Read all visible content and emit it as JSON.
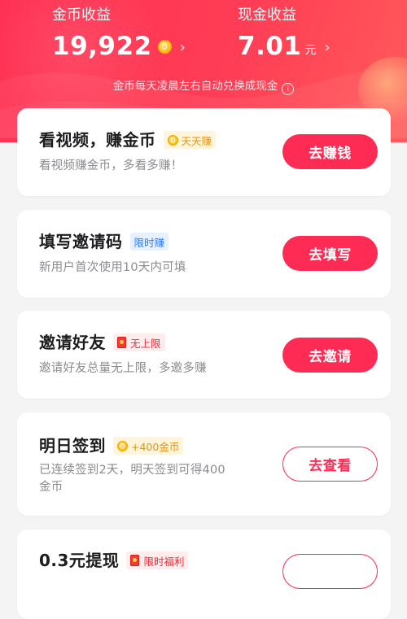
{
  "header": {
    "coins_label": "金币收益",
    "coins_value": "19,922",
    "cash_label": "现金收益",
    "cash_value": "7.01",
    "cash_unit": "元",
    "notice": "金币每天凌晨左右自动兑换成现金",
    "chevron": "›",
    "info": "i"
  },
  "tasks": [
    {
      "title": "看视频，赚金币",
      "tag": "天天赚",
      "tag_style": "gold",
      "tag_icon": "coin-icon",
      "desc": "看视频赚金币，多看多赚！",
      "button": "去赚钱",
      "button_style": "filled"
    },
    {
      "title": "填写邀请码",
      "tag": "限时赚",
      "tag_style": "blue",
      "desc": "新用户首次使用10天内可填",
      "button": "去填写",
      "button_style": "filled"
    },
    {
      "title": "邀请好友",
      "tag": "无上限",
      "tag_style": "red",
      "tag_icon": "red-envelope-icon",
      "desc": "邀请好友总量无上限，多邀多赚",
      "button": "去邀请",
      "button_style": "filled"
    },
    {
      "title": "明日签到",
      "tag": "+400金币",
      "tag_style": "gold",
      "tag_icon": "coin-icon",
      "desc_line1": "已连续签到2天，明天签到可得400",
      "desc_line2": "金币",
      "button": "去查看",
      "button_style": "outline"
    },
    {
      "title": "0.3元提现",
      "tag": "限时福利",
      "tag_style": "red",
      "tag_icon": "red-envelope-icon",
      "button_style": "outline"
    }
  ],
  "colors": {
    "brand": "#fe2c55",
    "header_start": "#ff2f52",
    "header_end": "#ff5b5b",
    "gold": "#e59411",
    "blue": "#2f7cf6"
  }
}
